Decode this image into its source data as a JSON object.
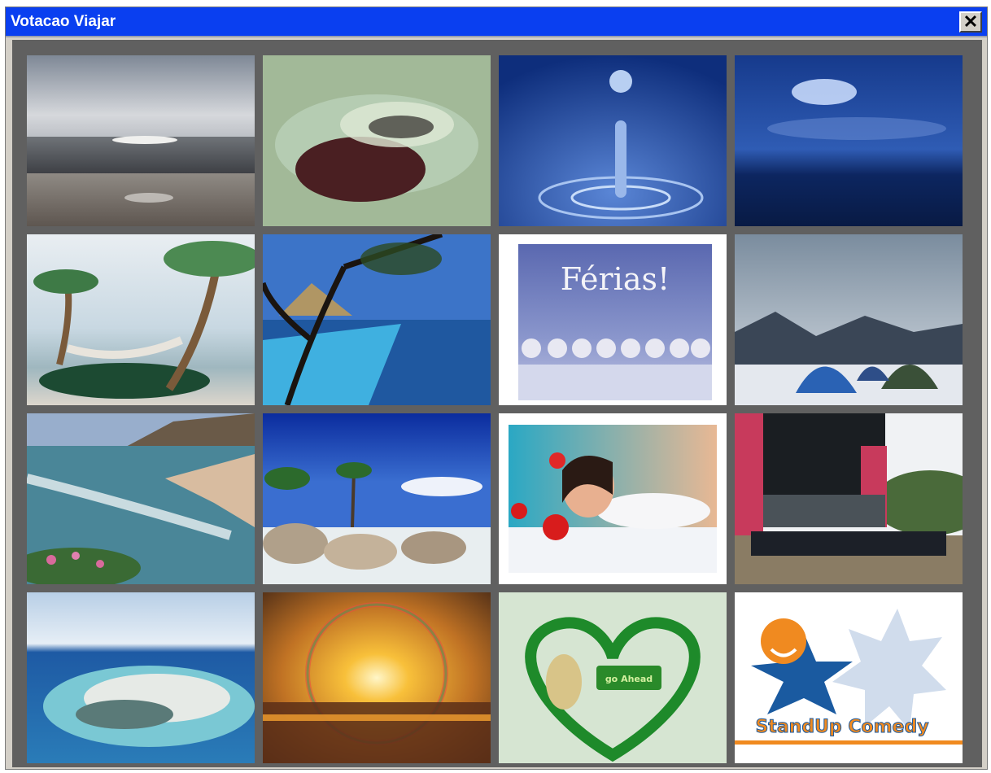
{
  "window": {
    "title": "Votacao Viajar",
    "close_icon": "close-icon",
    "close_glyph": "✕"
  },
  "gallery": {
    "items": [
      {
        "name": "beach-sunrise-photo"
      },
      {
        "name": "stingray-in-sand-photo"
      },
      {
        "name": "water-drop-photo"
      },
      {
        "name": "blue-night-sky-photo"
      },
      {
        "name": "hammock-palms-photo"
      },
      {
        "name": "infinity-pool-photo"
      },
      {
        "name": "ferias-winter-trees-card",
        "caption": "Férias!"
      },
      {
        "name": "snow-camping-tents-photo"
      },
      {
        "name": "coastal-cliff-beach-photo"
      },
      {
        "name": "tropical-granite-rocks-photo"
      },
      {
        "name": "spa-woman-flowers-photo"
      },
      {
        "name": "concert-stage-crowd-photo"
      },
      {
        "name": "atoll-aerial-photo"
      },
      {
        "name": "sunset-lens-flare-photo"
      },
      {
        "name": "green-heart-cartoon-card",
        "caption": "go Ahead"
      },
      {
        "name": "standup-comedy-logo",
        "caption": "StandUp Comedy"
      }
    ]
  }
}
